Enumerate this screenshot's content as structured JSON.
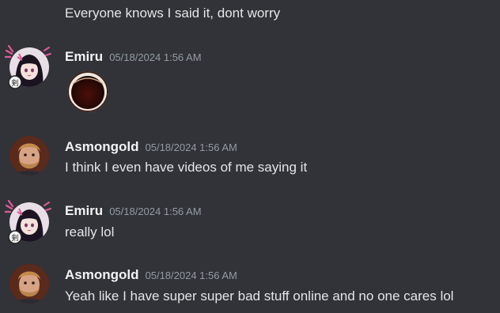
{
  "messages": [
    {
      "continuation_text": "Everyone knows I said it, dont worry"
    },
    {
      "author": "Emiru",
      "timestamp": "05/18/2024 1:56 AM",
      "content_type": "emoji",
      "emoji": "coffee-ring-emoji"
    },
    {
      "author": "Asmongold",
      "timestamp": "05/18/2024 1:56 AM",
      "text": "I think I even have videos of me saying it"
    },
    {
      "author": "Emiru",
      "timestamp": "05/18/2024 1:56 AM",
      "text": "really lol"
    },
    {
      "author": "Asmongold",
      "timestamp": "05/18/2024 1:56 AM",
      "text": "Yeah like I have super super bad stuff online and no one cares lol"
    }
  ],
  "colors": {
    "background": "#313338",
    "username": "#f2f3f5",
    "timestamp": "#949ba4",
    "message_text": "#e3e5e8",
    "emiru_accent": "#e05a9a"
  },
  "icons": {
    "emiru_avatar": "anime-girl-avatar",
    "asmongold_avatar": "bearded-man-avatar"
  }
}
